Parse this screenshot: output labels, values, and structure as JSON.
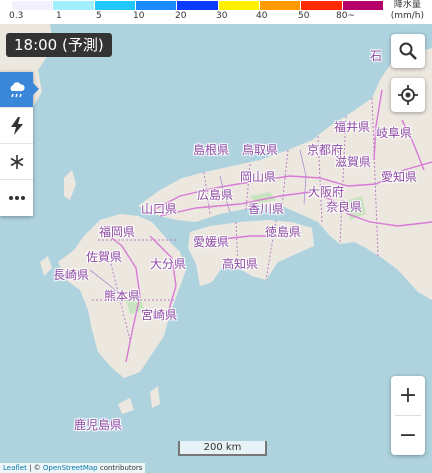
{
  "legend": {
    "colors": [
      "#f2f2ff",
      "#a0f0ff",
      "#20c8ff",
      "#1a8cff",
      "#0a3cff",
      "#fff000",
      "#ff9a00",
      "#ff2a00",
      "#b40068"
    ],
    "ticks": [
      "0.3",
      "1",
      "5",
      "10",
      "20",
      "30",
      "40",
      "50",
      "80~"
    ],
    "unit_title": "降水量",
    "unit": "(mm/h)"
  },
  "time_label": "18:00 (予測)",
  "layers": [
    {
      "name": "rain",
      "icon": "rain-cloud-icon",
      "active": true
    },
    {
      "name": "lightning",
      "icon": "lightning-icon",
      "active": false
    },
    {
      "name": "snow",
      "icon": "snowflake-icon",
      "active": false
    },
    {
      "name": "more",
      "icon": "more-icon",
      "active": false
    }
  ],
  "buttons": {
    "search_icon": "search-icon",
    "locate_icon": "crosshair-icon",
    "zoom_in": "+",
    "zoom_out": "−"
  },
  "scale_label": "200 km",
  "attribution": {
    "leaflet": "Leaflet",
    "sep": " | © ",
    "osm": "OpenStreetMap",
    "tail": " contributors"
  },
  "map_labels": {
    "shimane": "島根県",
    "tottori": "鳥取県",
    "fukui": "福井県",
    "gifu": "岐阜県",
    "kyoto": "京都府",
    "shiga": "滋賀県",
    "aichi": "愛知県",
    "okayama": "岡山県",
    "hiroshima": "広島県",
    "osaka": "大阪府",
    "yamaguchi": "山口県",
    "kagawa": "香川県",
    "nara": "奈良県",
    "fukuoka": "福岡県",
    "ehime": "愛媛県",
    "tokushima": "徳島県",
    "saga": "佐賀県",
    "oita": "大分県",
    "kochi": "高知県",
    "nagasaki": "長崎県",
    "kumamoto": "熊本県",
    "miyazaki": "宮崎県",
    "kagoshima": "鹿児島県",
    "ishikawa_partial": "石"
  }
}
